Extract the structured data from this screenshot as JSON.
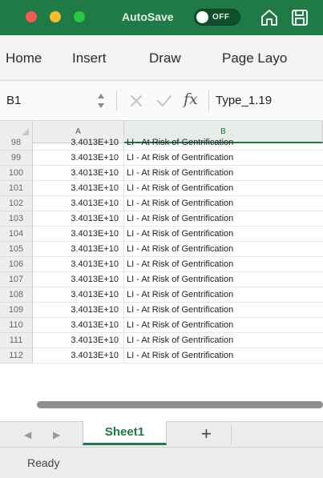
{
  "titlebar": {
    "autosave_label": "AutoSave",
    "autosave_state": "OFF"
  },
  "ribbon": {
    "tabs": [
      "Home",
      "Insert",
      "Draw",
      "Page Layo"
    ]
  },
  "formula_bar": {
    "name_box": "B1",
    "fx_symbol": "fx",
    "formula_value": "Type_1.19"
  },
  "grid": {
    "columns": [
      "A",
      "B"
    ],
    "rows": [
      {
        "num": "98",
        "a": "3.4013E+10",
        "b": "LI - At Risk of Gentrification"
      },
      {
        "num": "99",
        "a": "3.4013E+10",
        "b": "LI - At Risk of Gentrification"
      },
      {
        "num": "100",
        "a": "3.4013E+10",
        "b": "LI - At Risk of Gentrification"
      },
      {
        "num": "101",
        "a": "3.4013E+10",
        "b": "LI - At Risk of Gentrification"
      },
      {
        "num": "102",
        "a": "3.4013E+10",
        "b": "LI - At Risk of Gentrification"
      },
      {
        "num": "103",
        "a": "3.4013E+10",
        "b": "LI - At Risk of Gentrification"
      },
      {
        "num": "104",
        "a": "3.4013E+10",
        "b": "LI - At Risk of Gentrification"
      },
      {
        "num": "105",
        "a": "3.4013E+10",
        "b": "LI - At Risk of Gentrification"
      },
      {
        "num": "106",
        "a": "3.4013E+10",
        "b": "LI - At Risk of Gentrification"
      },
      {
        "num": "107",
        "a": "3.4013E+10",
        "b": "LI - At Risk of Gentrification"
      },
      {
        "num": "108",
        "a": "3.4013E+10",
        "b": "LI - At Risk of Gentrification"
      },
      {
        "num": "109",
        "a": "3.4013E+10",
        "b": "LI - At Risk of Gentrification"
      },
      {
        "num": "110",
        "a": "3.4013E+10",
        "b": "LI - At Risk of Gentrification"
      },
      {
        "num": "111",
        "a": "3.4013E+10",
        "b": "LI - At Risk of Gentrification"
      },
      {
        "num": "112",
        "a": "3.4013E+10",
        "b": "LI - At Risk of Gentrification"
      }
    ]
  },
  "sheet_tabs": {
    "active": "Sheet1",
    "add_label": "+"
  },
  "status": {
    "text": "Ready"
  },
  "colors": {
    "accent": "#1f7a45"
  },
  "icons": [
    "home-icon",
    "save-icon",
    "stepper-icon",
    "cancel-icon",
    "enter-icon",
    "fx-icon",
    "chevron-left-icon",
    "chevron-right-icon"
  ]
}
